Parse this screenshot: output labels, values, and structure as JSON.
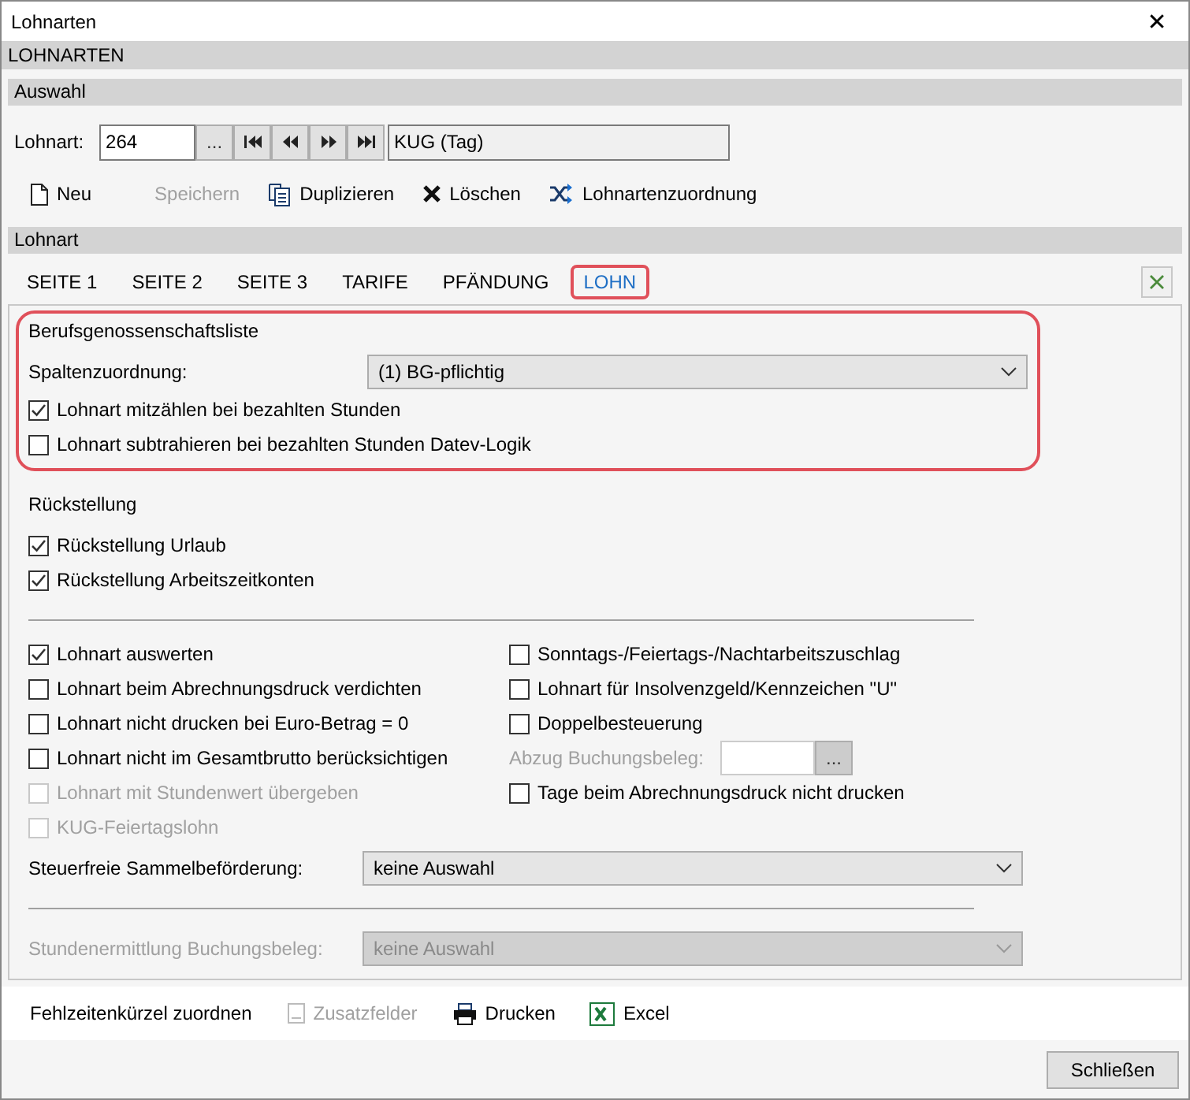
{
  "window": {
    "title": "Lohnarten",
    "close": "✕"
  },
  "header": "LOHNARTEN",
  "selection": {
    "title": "Auswahl",
    "label": "Lohnart:",
    "value": "264",
    "browse": "...",
    "description": "KUG (Tag)"
  },
  "toolbar": [
    {
      "label": "Neu",
      "kind": "new",
      "disabled": false
    },
    {
      "label": "Speichern",
      "kind": "save",
      "disabled": true
    },
    {
      "label": "Duplizieren",
      "kind": "duplicate",
      "disabled": false
    },
    {
      "label": "Löschen",
      "kind": "delete",
      "disabled": false
    },
    {
      "label": "Lohnartenzuordnung",
      "kind": "shuffle",
      "disabled": false
    }
  ],
  "section": "Lohnart",
  "tabs": [
    {
      "label": "SEITE 1",
      "selected": false,
      "highlighted": false
    },
    {
      "label": "SEITE 2",
      "selected": false,
      "highlighted": false
    },
    {
      "label": "SEITE 3",
      "selected": false,
      "highlighted": false
    },
    {
      "label": "TARIFE",
      "selected": false,
      "highlighted": false
    },
    {
      "label": "PFÄNDUNG",
      "selected": false,
      "highlighted": false
    },
    {
      "label": "LOHN",
      "selected": true,
      "highlighted": true
    }
  ],
  "bg_group": {
    "title": "Berufsgenossenschaftsliste",
    "highlighted": true,
    "field": {
      "label": "Spaltenzuordnung:",
      "value": "(1) BG-pflichtig"
    },
    "checkboxes": [
      {
        "label": "Lohnart mitzählen bei bezahlten Stunden",
        "checked": true
      },
      {
        "label": "Lohnart subtrahieren bei bezahlten Stunden Datev-Logik",
        "checked": false
      }
    ]
  },
  "provision": {
    "title": "Rückstellung",
    "checkboxes": [
      {
        "label": "Rückstellung Urlaub",
        "checked": true
      },
      {
        "label": "Rückstellung Arbeitszeitkonten",
        "checked": true
      }
    ]
  },
  "options_left": [
    {
      "label": "Lohnart auswerten",
      "checked": true,
      "disabled": false
    },
    {
      "label": "Lohnart beim Abrechnungsdruck verdichten",
      "checked": false,
      "disabled": false
    },
    {
      "label": "Lohnart nicht drucken bei Euro-Betrag = 0",
      "checked": false,
      "disabled": false
    },
    {
      "label": "Lohnart nicht im Gesamtbrutto berücksichtigen",
      "checked": false,
      "disabled": false
    },
    {
      "label": "Lohnart mit Stundenwert übergeben",
      "checked": false,
      "disabled": true
    },
    {
      "label": "KUG-Feiertagslohn",
      "checked": false,
      "disabled": true
    }
  ],
  "options_right": [
    {
      "kind": "checkbox",
      "label": "Sonntags-/Feiertags-/Nachtarbeitszuschlag",
      "checked": false,
      "disabled": false
    },
    {
      "kind": "checkbox",
      "label": "Lohnart für Insolvenzgeld/Kennzeichen \"U\"",
      "checked": false,
      "disabled": false
    },
    {
      "kind": "checkbox",
      "label": "Doppelbesteuerung",
      "checked": false,
      "disabled": false
    },
    {
      "kind": "field",
      "label": "Abzug Buchungsbeleg:",
      "button": "...",
      "disabled": true
    },
    {
      "kind": "checkbox",
      "label": "Tage beim Abrechnungsdruck nicht drucken",
      "checked": false,
      "disabled": false
    }
  ],
  "transport": {
    "label": "Steuerfreie Sammelbeförderung:",
    "value": "keine Auswahl",
    "disabled": false
  },
  "hours": {
    "label": "Stundenermittlung Buchungsbeleg:",
    "value": "keine Auswahl",
    "disabled": true
  },
  "bottom_toolbar": [
    {
      "label": "Fehlzeitenkürzel zuordnen",
      "kind": "plain",
      "disabled": false
    },
    {
      "label": "Zusatzfelder",
      "kind": "fields",
      "disabled": true
    },
    {
      "label": "Drucken",
      "kind": "print",
      "disabled": false
    },
    {
      "label": "Excel",
      "kind": "excel",
      "disabled": false
    }
  ],
  "close_button": "Schließen"
}
